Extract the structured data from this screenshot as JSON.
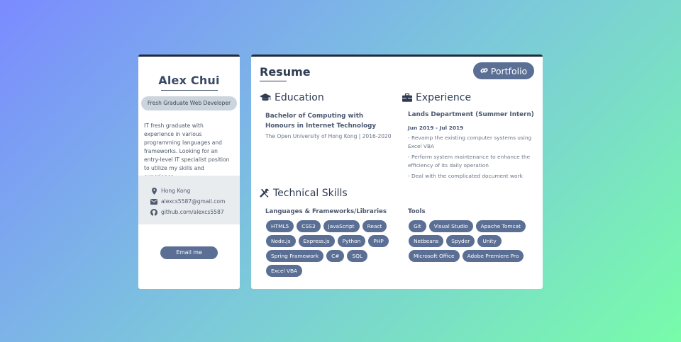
{
  "profile": {
    "name": "Alex Chui",
    "title": "Fresh Graduate Web Developer",
    "about": "IT fresh graduate with experience in various programming languages and frameworks. Looking for an entry-level IT specialist position to utilize my skills and experience.",
    "contacts": [
      {
        "icon": "map-marker-icon",
        "text": "Hong Kong"
      },
      {
        "icon": "envelope-icon",
        "text": "alexcs5587@gmail.com"
      },
      {
        "icon": "github-icon",
        "text": "github.com/alexcs5587"
      }
    ],
    "email_button": "Email me"
  },
  "resume": {
    "title": "Resume",
    "portfolio_button": "Portfolio",
    "education": {
      "heading": "Education",
      "degree": "Bachelor of Computing with Honours in Internet Technology",
      "school": "The Open University of Hong Kong | 2016-2020"
    },
    "experience": {
      "heading": "Experience",
      "role": "Lands Department (Summer Intern)",
      "dates": "Jun 2019 - Jul 2019",
      "items": [
        "- Revamp the existing computer systems using Excel VBA",
        "- Perform system maintenance to enhance the efficiency of its daily operation",
        "- Deal with the complicated document work"
      ]
    },
    "skills": {
      "heading": "Technical Skills",
      "languages_heading": "Languages & Frameworks/Libraries",
      "languages": [
        "HTML5",
        "CSS3",
        "JavaScript",
        "React",
        "Node.js",
        "Express.js",
        "Python",
        "PHP",
        "Spring Framework",
        "C#",
        "SQL",
        "Excel VBA"
      ],
      "tools_heading": "Tools",
      "tools": [
        "Git",
        "Visual Studio",
        "Apache Tomcat",
        "Netbeans",
        "Spyder",
        "Unity",
        "Microsoft Office",
        "Adobe Premiere Pro"
      ]
    }
  },
  "colors": {
    "accent": "#5b6f95",
    "heading": "#2f3c54",
    "pill_bg": "#ccd5dd"
  }
}
